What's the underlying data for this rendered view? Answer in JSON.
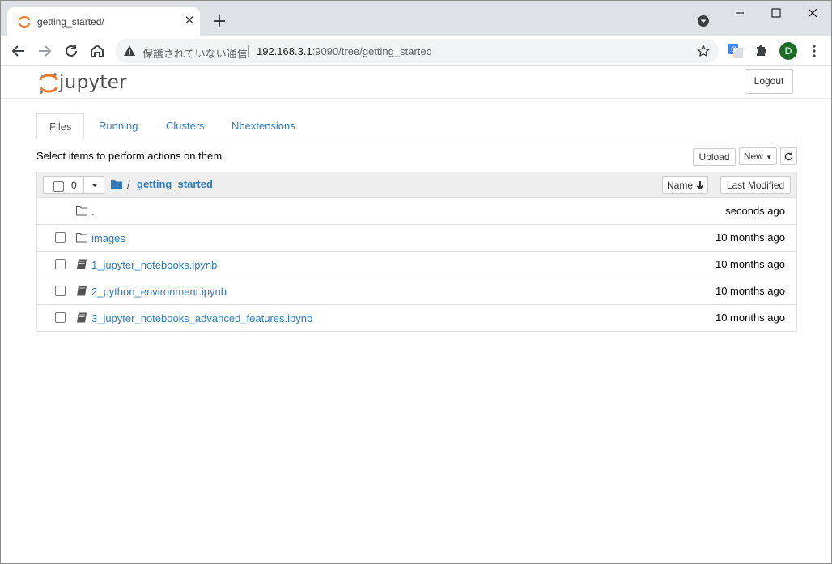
{
  "browser": {
    "tab_title": "getting_started/",
    "security_label": "保護されていない通信",
    "url_host": "192.168.3.1",
    "url_rest": ":9090/tree/getting_started",
    "avatar_letter": "D"
  },
  "header": {
    "logo_text": "jupyter",
    "logout_label": "Logout"
  },
  "tabs": [
    {
      "label": "Files",
      "active": true
    },
    {
      "label": "Running",
      "active": false
    },
    {
      "label": "Clusters",
      "active": false
    },
    {
      "label": "Nbextensions",
      "active": false
    }
  ],
  "toolbar": {
    "hint": "Select items to perform actions on them.",
    "upload_label": "Upload",
    "new_label": "New"
  },
  "list": {
    "selected_count": "0",
    "breadcrumb_sep": "/",
    "current_folder": "getting_started",
    "sort_name_label": "Name",
    "sort_modified_label": "Last Modified",
    "items": [
      {
        "name": "..",
        "type": "parent",
        "modified": "seconds ago"
      },
      {
        "name": "images",
        "type": "folder",
        "modified": "10 months ago"
      },
      {
        "name": "1_jupyter_notebooks.ipynb",
        "type": "notebook",
        "modified": "10 months ago"
      },
      {
        "name": "2_python_environment.ipynb",
        "type": "notebook",
        "modified": "10 months ago"
      },
      {
        "name": "3_jupyter_notebooks_advanced_features.ipynb",
        "type": "notebook",
        "modified": "10 months ago"
      }
    ]
  },
  "colors": {
    "link": "#337ab7",
    "jupyter_orange": "#f37726",
    "tabstrip_bg": "#dee1e6",
    "avatar_bg": "#1e6b28"
  }
}
